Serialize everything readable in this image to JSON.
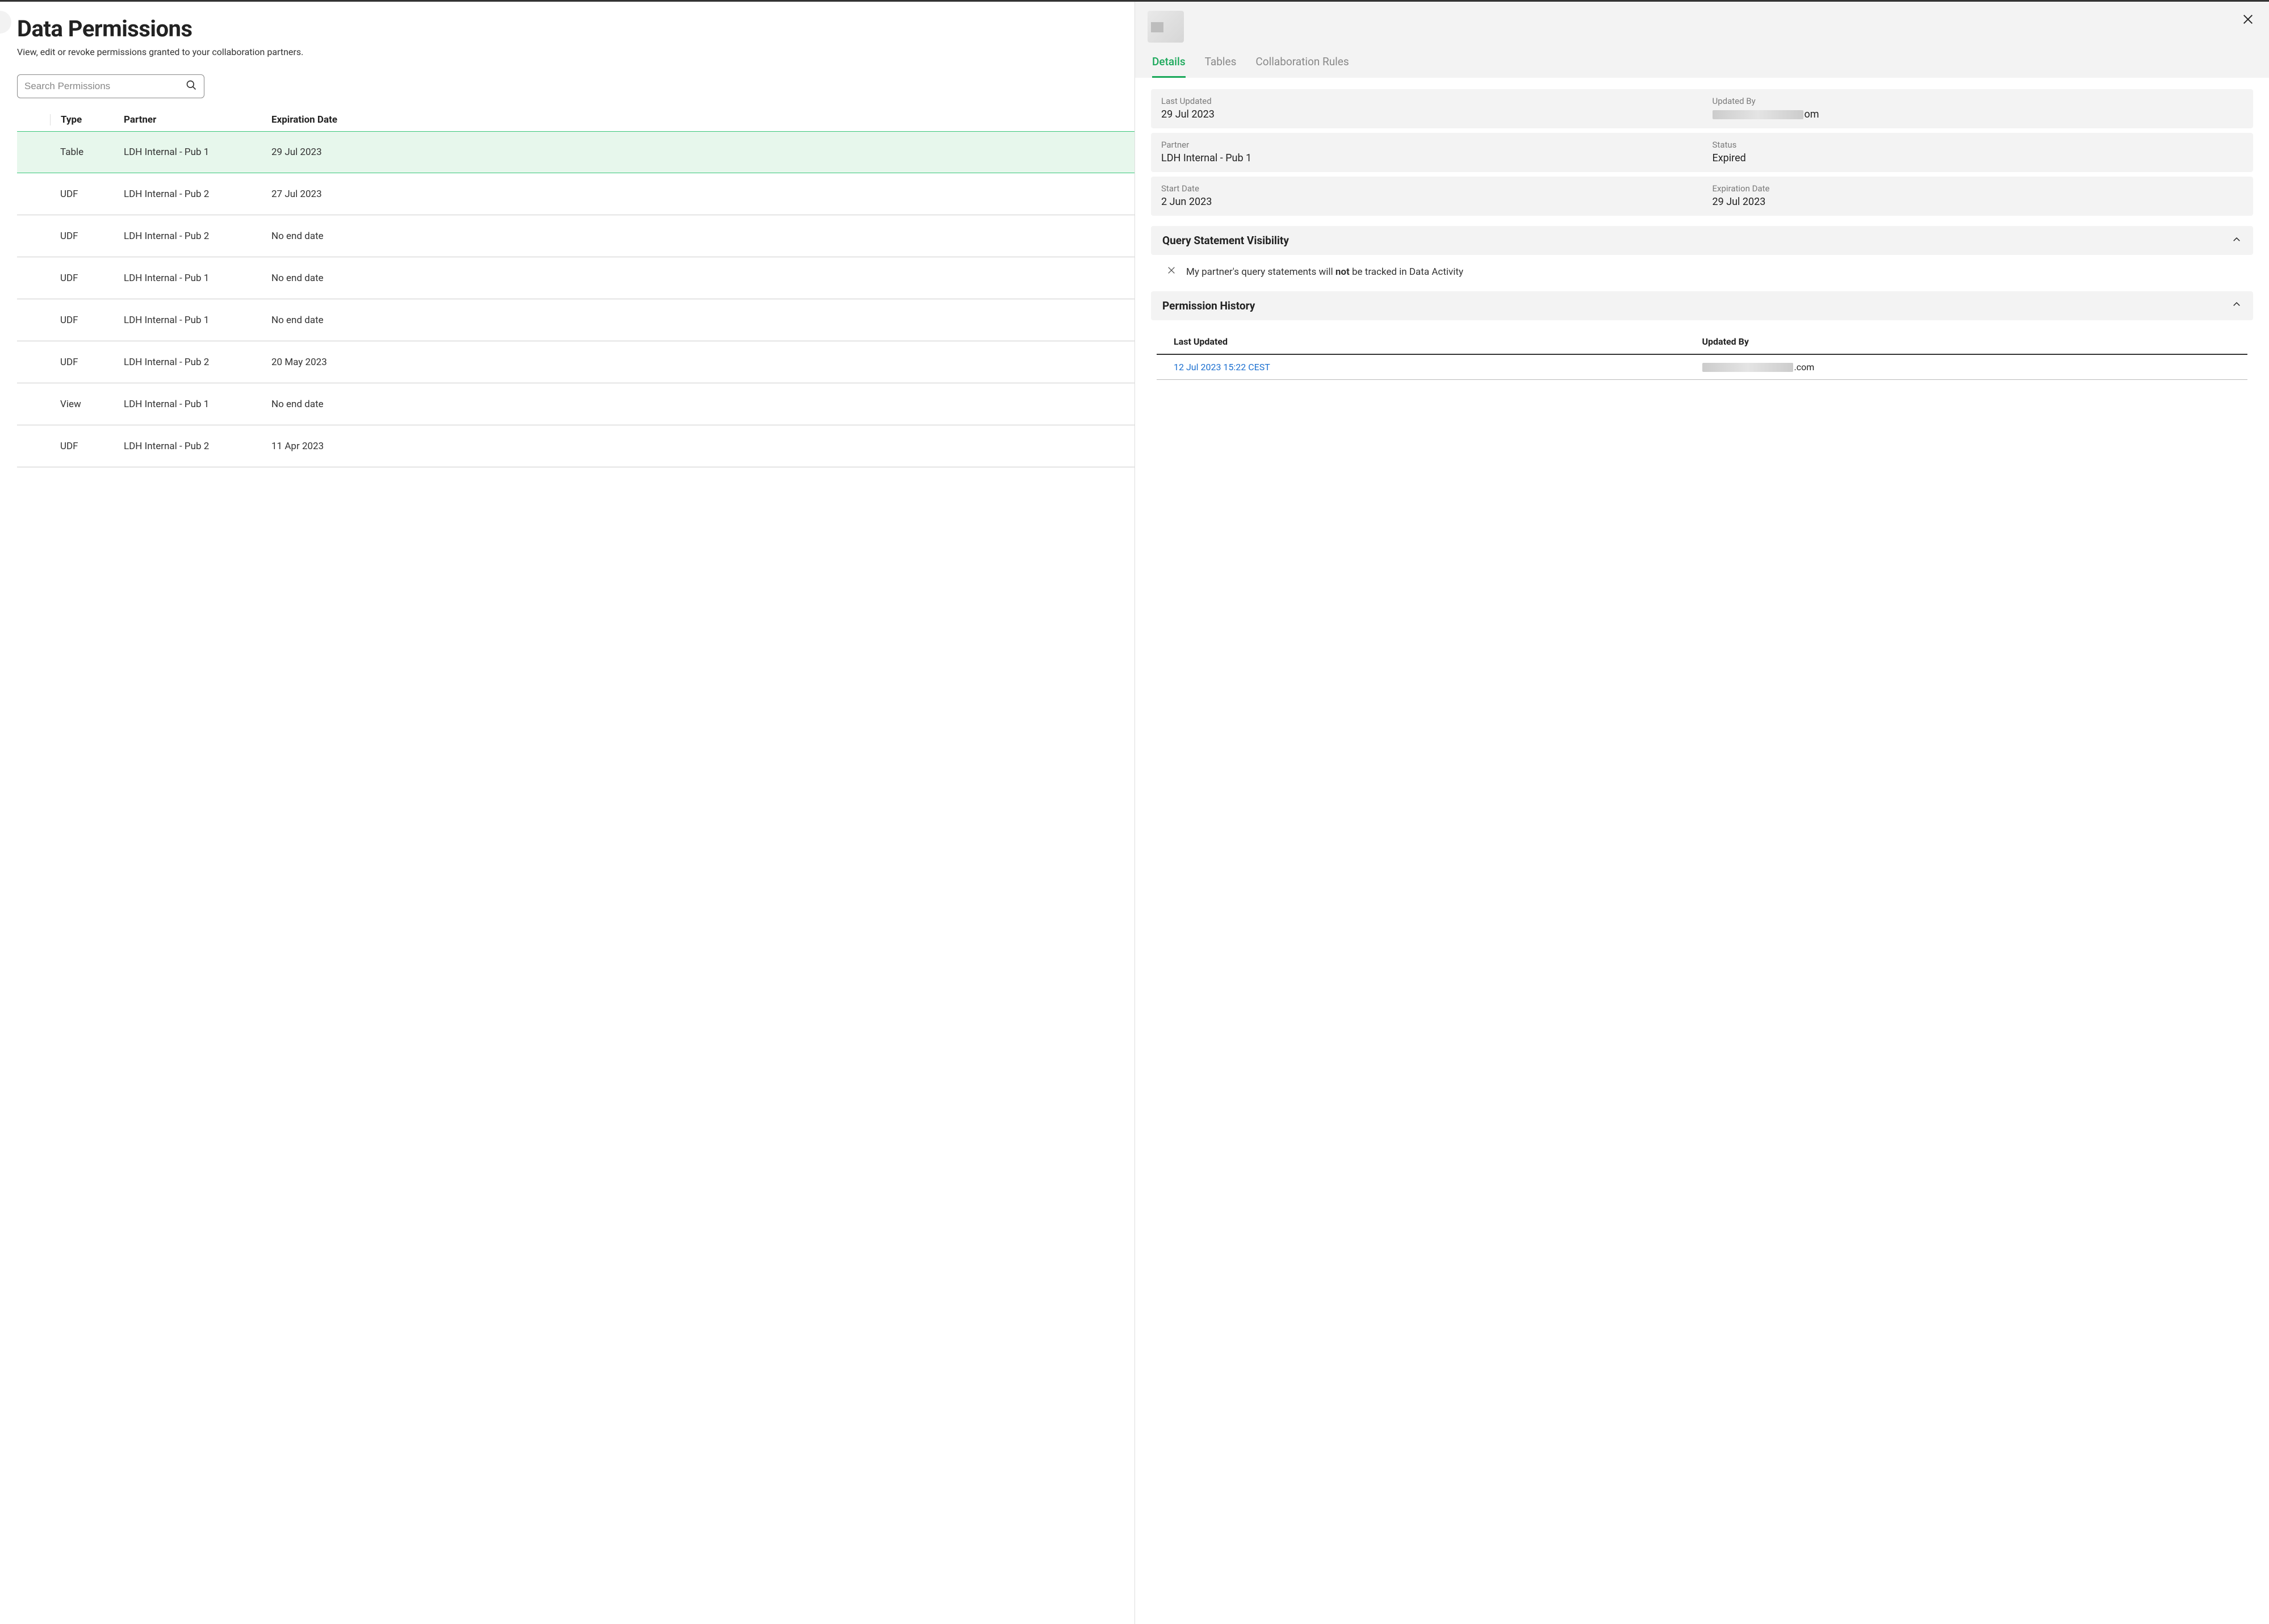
{
  "page": {
    "title": "Data Permissions",
    "subtitle": "View, edit or revoke permissions granted to your collaboration partners."
  },
  "search": {
    "placeholder": "Search Permissions"
  },
  "table": {
    "headers": {
      "type": "Type",
      "partner": "Partner",
      "expiration": "Expiration Date"
    },
    "rows": [
      {
        "type": "Table",
        "partner": "LDH Internal - Pub 1",
        "expiration": "29 Jul 2023",
        "selected": true
      },
      {
        "type": "UDF",
        "partner": "LDH Internal - Pub 2",
        "expiration": "27 Jul 2023"
      },
      {
        "type": "UDF",
        "partner": "LDH Internal - Pub 2",
        "expiration": "No end date"
      },
      {
        "type": "UDF",
        "partner": "LDH Internal - Pub 1",
        "expiration": "No end date"
      },
      {
        "type": "UDF",
        "partner": "LDH Internal - Pub 1",
        "expiration": "No end date"
      },
      {
        "type": "UDF",
        "partner": "LDH Internal - Pub 2",
        "expiration": "20 May 2023"
      },
      {
        "type": "View",
        "partner": "LDH Internal - Pub 1",
        "expiration": "No end date"
      },
      {
        "type": "UDF",
        "partner": "LDH Internal - Pub 2",
        "expiration": "11 Apr 2023"
      }
    ]
  },
  "panel": {
    "tabs": {
      "details": "Details",
      "tables": "Tables",
      "rules": "Collaboration Rules"
    },
    "info": {
      "last_updated": {
        "label": "Last Updated",
        "value": "29 Jul 2023"
      },
      "updated_by": {
        "label": "Updated By",
        "suffix": "om"
      },
      "partner": {
        "label": "Partner",
        "value": "LDH Internal - Pub 1"
      },
      "status": {
        "label": "Status",
        "value": "Expired"
      },
      "start_date": {
        "label": "Start Date",
        "value": "2 Jun 2023"
      },
      "expiration": {
        "label": "Expiration Date",
        "value": "29 Jul 2023"
      }
    },
    "qsv": {
      "title": "Query Statement Visibility",
      "text_pre": "My partner's query statements will ",
      "text_bold": "not",
      "text_post": " be tracked in Data Activity"
    },
    "history": {
      "title": "Permission History",
      "headers": {
        "last_updated": "Last Updated",
        "updated_by": "Updated By"
      },
      "rows": [
        {
          "date": "12 Jul 2023 15:22 CEST",
          "by_suffix": ".com"
        }
      ]
    }
  }
}
